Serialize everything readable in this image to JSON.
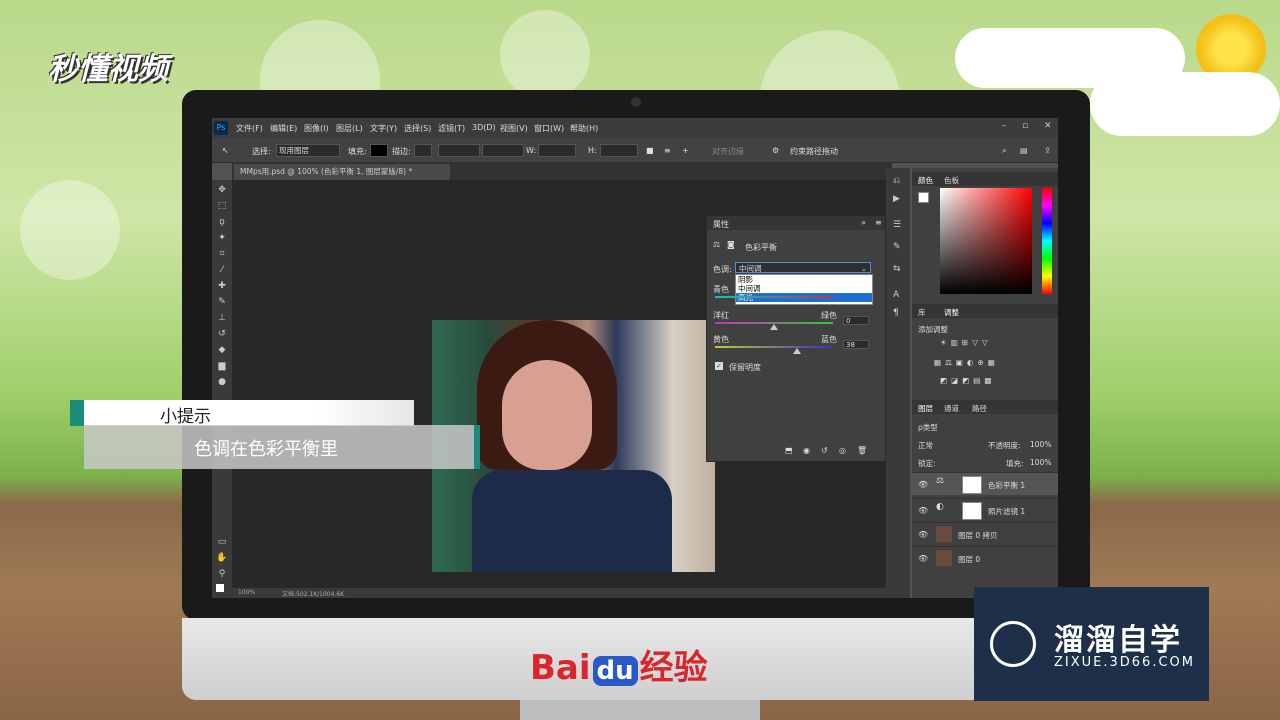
{
  "brand_top": "秒懂视频",
  "photoshop": {
    "menus": [
      "文件(F)",
      "编辑(E)",
      "图像(I)",
      "图层(L)",
      "文字(Y)",
      "选择(S)",
      "滤镜(T)",
      "3D(D)",
      "视图(V)",
      "窗口(W)",
      "帮助(H)"
    ],
    "options": {
      "select_label": "选择:",
      "select_value": "现用图层",
      "fill_label": "填充:",
      "stroke_label": "描边:",
      "w_label": "W:",
      "h_label": "H:",
      "align_edges": "对齐边缘",
      "constrain_path": "约束路径拖动"
    },
    "document_tab": "MMps用.psd @ 100% (色彩平衡 1, 图层蒙版/8) *",
    "status": {
      "zoom": "100%",
      "doc": "文档:502.1K/1004.6K"
    },
    "properties": {
      "title": "属性",
      "panel_name": "色彩平衡",
      "tone_label": "色调:",
      "tone_value": "中间调",
      "tone_options": [
        "阴影",
        "中间调",
        "高光"
      ],
      "selected_option": "高光",
      "cyan": "青色",
      "red": "红色",
      "magenta": "洋红",
      "green": "绿色",
      "magenta_value": "0",
      "yellow": "黄色",
      "blue": "蓝色",
      "yellow_value": "38",
      "preserve": "保留明度"
    },
    "right_panel": {
      "color_tabs": [
        "颜色",
        "色板"
      ],
      "adj_tabs": [
        "库",
        "调整"
      ],
      "add_adjustment": "添加调整",
      "layer_tabs": [
        "图层",
        "通道",
        "路径"
      ],
      "kind_label": "ρ类型",
      "blend_mode": "正常",
      "opacity_label": "不透明度:",
      "opacity_value": "100%",
      "lock_label": "锁定:",
      "fill_label": "填充:",
      "fill_value": "100%",
      "layers": [
        "色彩平衡 1",
        "照片滤镜 1",
        "图层 0 拷贝",
        "图层 0"
      ]
    }
  },
  "tip": {
    "title": "小提示",
    "text": "色调在色彩平衡里"
  },
  "baidu": {
    "bai": "Bai",
    "du": "du",
    "jingyan": "经验"
  },
  "zixue": {
    "name": "溜溜自学",
    "url": "ZIXUE.3D66.COM"
  }
}
